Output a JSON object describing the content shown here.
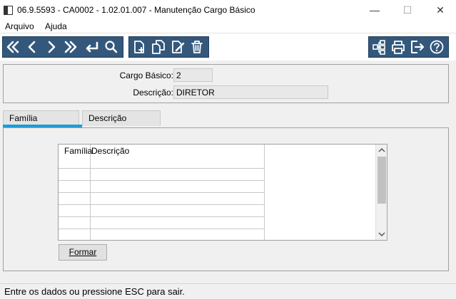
{
  "window": {
    "title": "06.9.5593 - CA0002 - 1.02.01.007 - Manutenção Cargo Básico",
    "minimize_glyph": "—",
    "maximize_glyph": "☐",
    "close_glyph": "✕"
  },
  "menu": {
    "items": [
      {
        "label": "Arquivo"
      },
      {
        "label": "Ajuda"
      }
    ]
  },
  "toolbar": {
    "background": "#33587c",
    "nav_icons": [
      "first-record-icon",
      "previous-record-icon",
      "next-record-icon",
      "last-record-icon",
      "goto-enter-icon",
      "search-icon"
    ],
    "edit_icons": [
      "new-record-icon",
      "copy-record-icon",
      "edit-record-icon",
      "delete-record-icon"
    ],
    "util_icons": [
      "hierarchy-icon",
      "print-icon",
      "exit-icon",
      "help-icon"
    ]
  },
  "form": {
    "cargo_basico_label": "Cargo Básico:",
    "cargo_basico_value": "2",
    "descricao_label": "Descrição:",
    "descricao_value": "DIRETOR"
  },
  "tabs": [
    {
      "label": "Família",
      "active": true
    },
    {
      "label": "Descrição",
      "active": false
    }
  ],
  "grid": {
    "columns": [
      "Família",
      "Descrição"
    ],
    "rows": [
      [
        "",
        ""
      ],
      [
        "",
        ""
      ],
      [
        "",
        ""
      ],
      [
        "",
        ""
      ],
      [
        "",
        ""
      ],
      [
        "",
        ""
      ]
    ]
  },
  "buttons": {
    "formar_label": "Formar"
  },
  "status": {
    "text": "Entre os dados ou pressione ESC para sair."
  }
}
